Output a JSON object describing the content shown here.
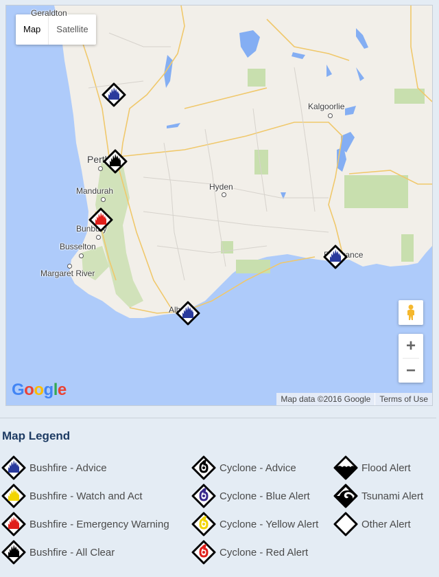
{
  "map": {
    "type_controls": {
      "map_label": "Map",
      "satellite_label": "Satellite",
      "selected": "Map"
    },
    "cities": [
      {
        "name": "Geraldton"
      },
      {
        "name": "Kalgoorlie"
      },
      {
        "name": "Perth"
      },
      {
        "name": "Mandurah"
      },
      {
        "name": "Hyden"
      },
      {
        "name": "Bunbury"
      },
      {
        "name": "Busselton"
      },
      {
        "name": "Margaret River"
      },
      {
        "name": "Esperance"
      },
      {
        "name": "Albany"
      }
    ],
    "markers": [
      {
        "type": "Bushfire - Advice",
        "color": "#2a3a9c",
        "near": "north of Perth"
      },
      {
        "type": "Bushfire - All Clear",
        "color": "#000000",
        "near": "Perth"
      },
      {
        "type": "Bushfire - Emergency Warning",
        "color": "#e0201b",
        "near": "Bunbury"
      },
      {
        "type": "Bushfire - Advice",
        "color": "#2a3a9c",
        "near": "Albany"
      },
      {
        "type": "Bushfire - Advice",
        "color": "#2a3a9c",
        "near": "Esperance"
      }
    ],
    "logo": "Google",
    "attribution": "Map data ©2016 Google",
    "terms": "Terms of Use",
    "zoom_in": "+",
    "zoom_out": "−",
    "pegman_icon": "street-view-pegman"
  },
  "legend": {
    "title": "Map Legend",
    "items": [
      {
        "label": "Bushfire - Advice",
        "icon": "bushfire",
        "color": "#2a3a9c"
      },
      {
        "label": "Bushfire - Watch and Act",
        "icon": "bushfire",
        "color": "#f2d500"
      },
      {
        "label": "Bushfire - Emergency Warning",
        "icon": "bushfire",
        "color": "#e0201b"
      },
      {
        "label": "Bushfire - All Clear",
        "icon": "bushfire",
        "color": "#000000"
      },
      {
        "label": "Cyclone - Advice",
        "icon": "cyclone",
        "color": "#000000"
      },
      {
        "label": "Cyclone - Blue Alert",
        "icon": "cyclone",
        "color": "#3a2a8c"
      },
      {
        "label": "Cyclone - Yellow Alert",
        "icon": "cyclone",
        "color": "#f2d500"
      },
      {
        "label": "Cyclone - Red Alert",
        "icon": "cyclone",
        "color": "#e0201b"
      },
      {
        "label": "Flood Alert",
        "icon": "flood",
        "color": "#000000"
      },
      {
        "label": "Tsunami Alert",
        "icon": "tsunami",
        "color": "#000000"
      },
      {
        "label": "Other Alert",
        "icon": "other",
        "color": "#ffffff"
      }
    ]
  }
}
